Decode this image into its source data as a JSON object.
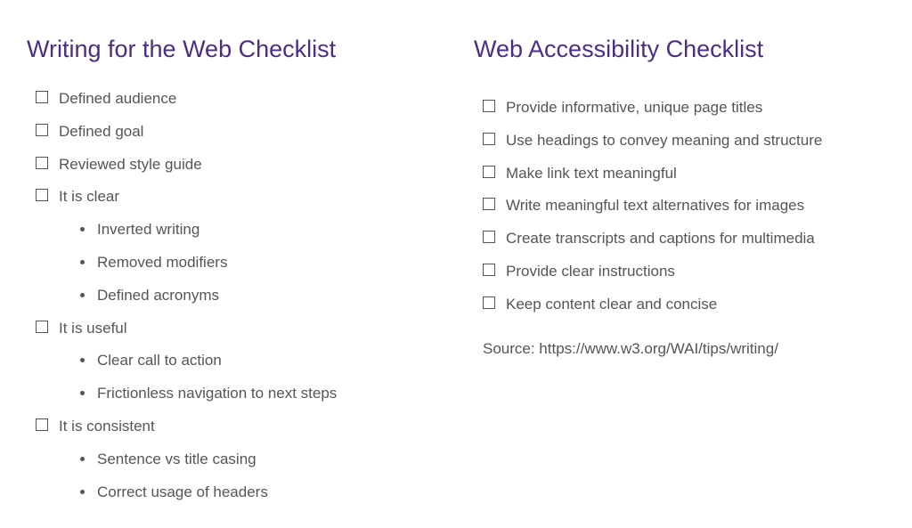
{
  "left": {
    "title": "Writing for the Web Checklist",
    "items": [
      {
        "label": "Defined audience"
      },
      {
        "label": "Defined goal"
      },
      {
        "label": "Reviewed style guide"
      },
      {
        "label": "It is clear",
        "sub": [
          "Inverted writing",
          "Removed modifiers",
          "Defined acronyms"
        ]
      },
      {
        "label": "It is useful",
        "sub": [
          "Clear call to action",
          "Frictionless navigation to next steps"
        ]
      },
      {
        "label": "It is consistent",
        "sub": [
          "Sentence vs title casing",
          "Correct usage of headers"
        ]
      }
    ]
  },
  "right": {
    "title": "Web Accessibility Checklist",
    "items": [
      {
        "label": "Provide informative, unique page titles"
      },
      {
        "label": "Use headings to convey meaning and structure"
      },
      {
        "label": "Make link text meaningful"
      },
      {
        "label": "Write meaningful text alternatives for images"
      },
      {
        "label": "Create transcripts and captions for multimedia"
      },
      {
        "label": "Provide clear instructions"
      },
      {
        "label": "Keep content clear and concise"
      }
    ],
    "source": "Source: https://www.w3.org/WAI/tips/writing/"
  }
}
